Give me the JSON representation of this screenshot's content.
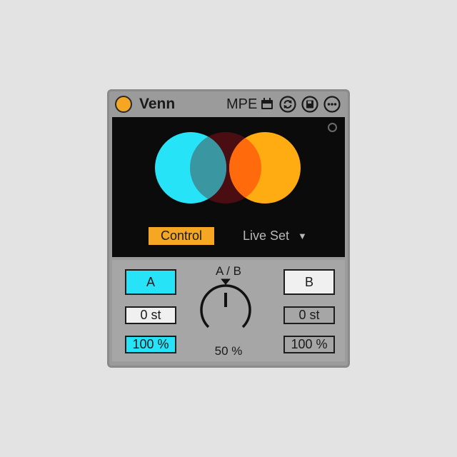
{
  "device": {
    "title": "Venn",
    "mpe_label": "MPE",
    "power_color": "#f5a623",
    "icons": [
      "device-on-icon",
      "calendar-icon",
      "hot-swap-icon",
      "save-icon",
      "more-icon"
    ]
  },
  "display": {
    "colors": {
      "circle_a": "#26e3f7",
      "circle_b": "#ffab12",
      "circle_mid": "#4a0e12"
    },
    "control_label": "Control",
    "source_label": "Live Set"
  },
  "controls": {
    "a": {
      "label": "A",
      "transpose": "0 st",
      "level": "100 %"
    },
    "b": {
      "label": "B",
      "transpose": "0 st",
      "level": "100 %"
    },
    "mix": {
      "label": "A / B",
      "value_text": "50 %",
      "value": 0.5
    }
  }
}
